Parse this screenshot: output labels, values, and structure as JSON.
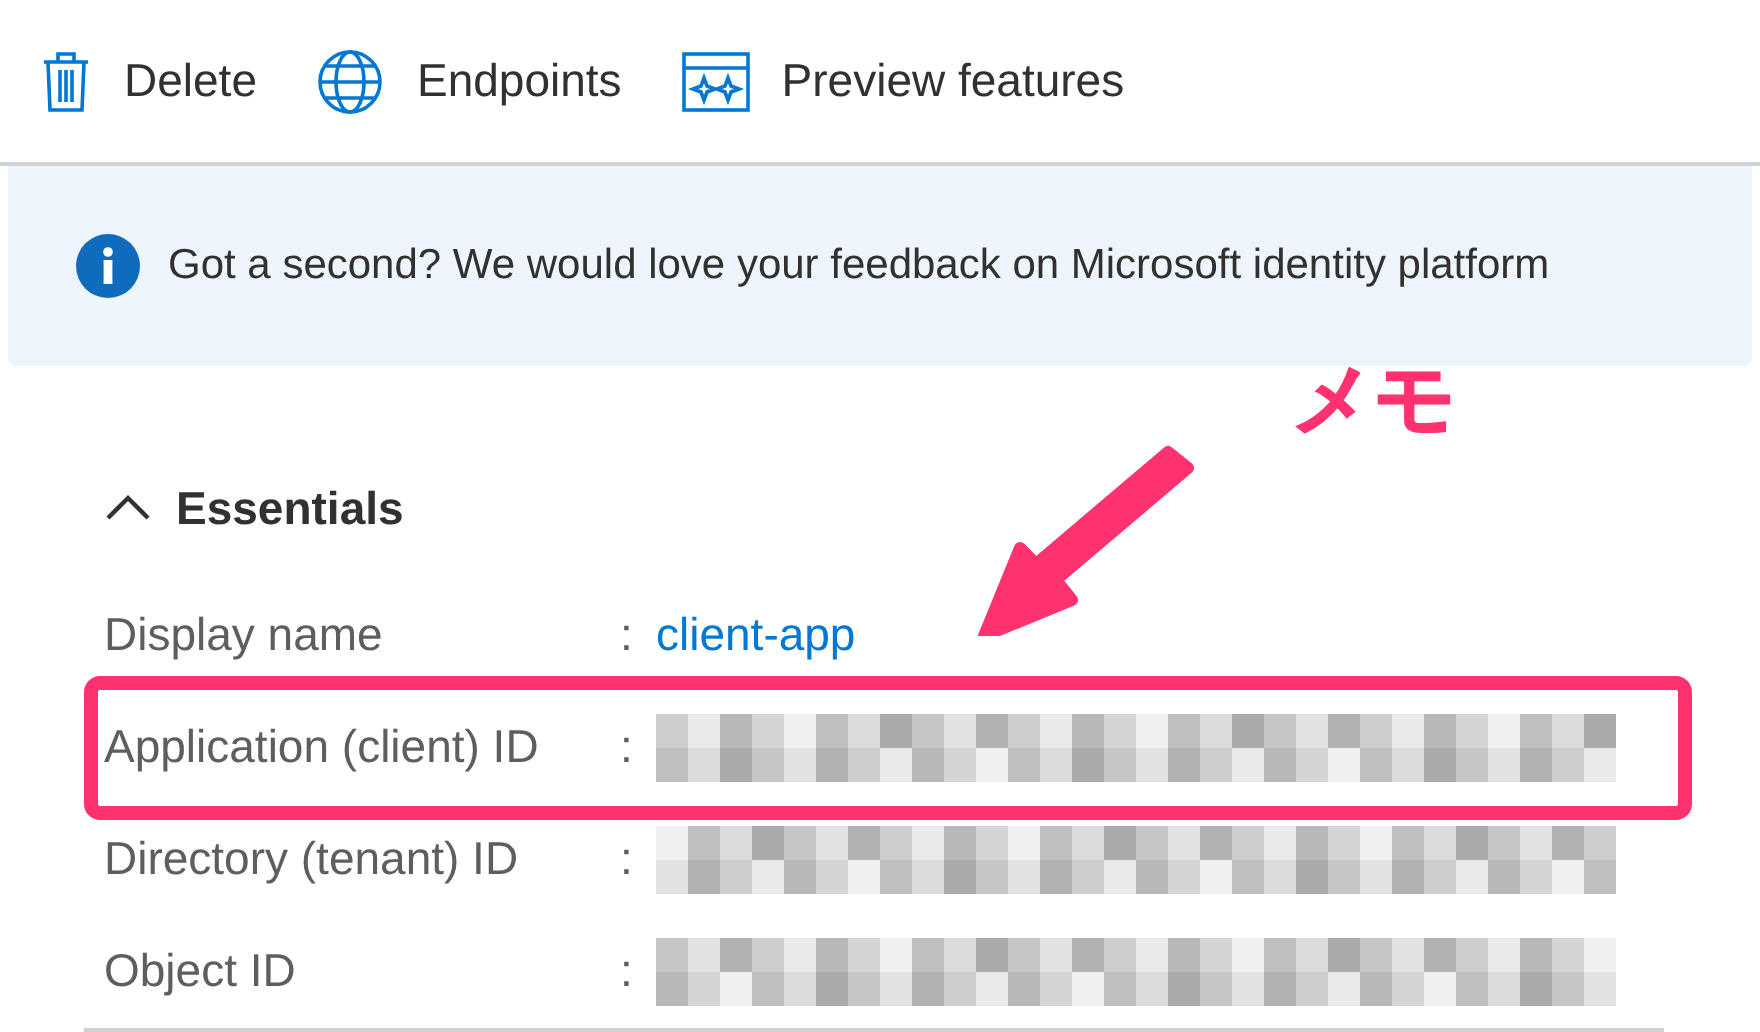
{
  "toolbar": [
    {
      "kind": "delete",
      "label": "Delete"
    },
    {
      "kind": "endpoints",
      "label": "Endpoints"
    },
    {
      "kind": "preview",
      "label": "Preview features"
    }
  ],
  "banner": {
    "text": "Got a second? We would love your feedback on Microsoft identity platform"
  },
  "essentials": {
    "title": "Essentials",
    "expanded": true,
    "rows": [
      {
        "label": "Display name",
        "separator": ":",
        "kind": "link",
        "value": "client-app",
        "highlighted": false
      },
      {
        "label": "Application (client) ID",
        "separator": ":",
        "kind": "redacted",
        "highlighted": true
      },
      {
        "label": "Directory (tenant) ID",
        "separator": ":",
        "kind": "redacted",
        "highlighted": false
      },
      {
        "label": "Object ID",
        "separator": ":",
        "kind": "redacted",
        "highlighted": false
      }
    ]
  },
  "annotation": {
    "label": "メモ"
  }
}
